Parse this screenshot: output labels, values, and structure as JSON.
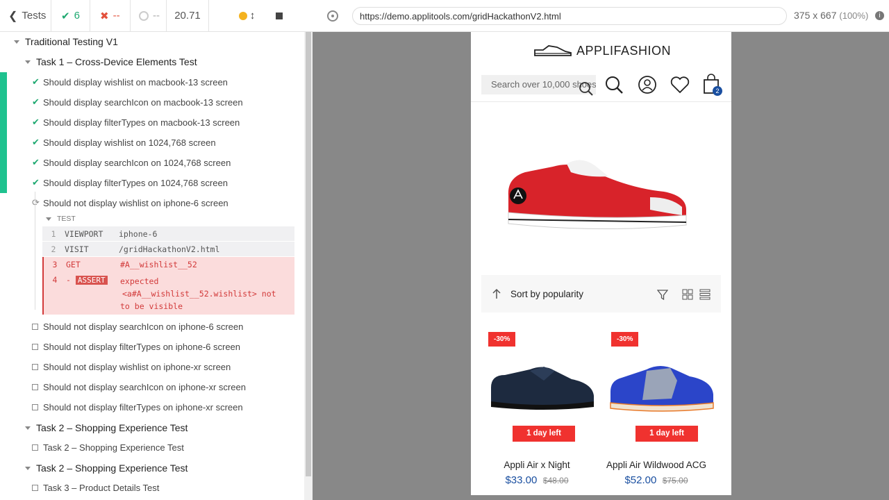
{
  "topbar": {
    "back_label": "Tests",
    "passed": "6",
    "failed": "--",
    "pending": "--",
    "duration": "20.71"
  },
  "browser": {
    "url": "https://demo.applitools.com/gridHackathonV2.html",
    "viewport": "375 x 667",
    "zoom": "(100%)"
  },
  "tree": {
    "root": "Traditional Testing V1",
    "task1": "Task 1 – Cross-Device Elements Test",
    "passed_tests": [
      "Should display wishlist on macbook-13 screen",
      "Should display searchIcon on macbook-13 screen",
      "Should display filterTypes on macbook-13 screen",
      "Should display wishlist on 1024,768 screen",
      "Should display searchIcon on 1024,768 screen",
      "Should display filterTypes on 1024,768 screen"
    ],
    "running_test": "Should not display wishlist on iphone-6 screen",
    "test_label": "TEST",
    "commands": [
      {
        "n": "1",
        "cmd": "VIEWPORT",
        "val": "iphone-6"
      },
      {
        "n": "2",
        "cmd": "VISIT",
        "val": "/gridHackathonV2.html"
      },
      {
        "n": "3",
        "cmd": "GET",
        "val": "#A__wishlist__52"
      },
      {
        "n": "4",
        "cmd": "ASSERT",
        "prefix": "-",
        "val1": "expected",
        "val2": "<a#A__wishlist__52.wishlist> not",
        "val3": "to be visible"
      }
    ],
    "pending_tests": [
      "Should not display searchIcon on iphone-6 screen",
      "Should not display filterTypes on iphone-6 screen",
      "Should not display wishlist on iphone-xr screen",
      "Should not display searchIcon on iphone-xr screen",
      "Should not display filterTypes on iphone-xr screen"
    ],
    "task2a": "Task 2 – Shopping Experience Test",
    "task2a_item": "Task 2 – Shopping Experience Test",
    "task2b": "Task 2 – Shopping Experience Test",
    "task2b_item": "Task 3 – Product Details Test"
  },
  "app": {
    "brand": "APPLIFASHION",
    "search_placeholder": "Search over 10,000 shoes!",
    "cart_count": "2",
    "sort_label": "Sort by popularity",
    "products": [
      {
        "discount": "-30%",
        "badge": "1 day left",
        "name": "Appli Air x Night",
        "price": "$33.00",
        "old_price": "$48.00"
      },
      {
        "discount": "-30%",
        "badge": "1 day left",
        "name": "Appli Air Wildwood ACG",
        "price": "$52.00",
        "old_price": "$75.00"
      }
    ]
  }
}
